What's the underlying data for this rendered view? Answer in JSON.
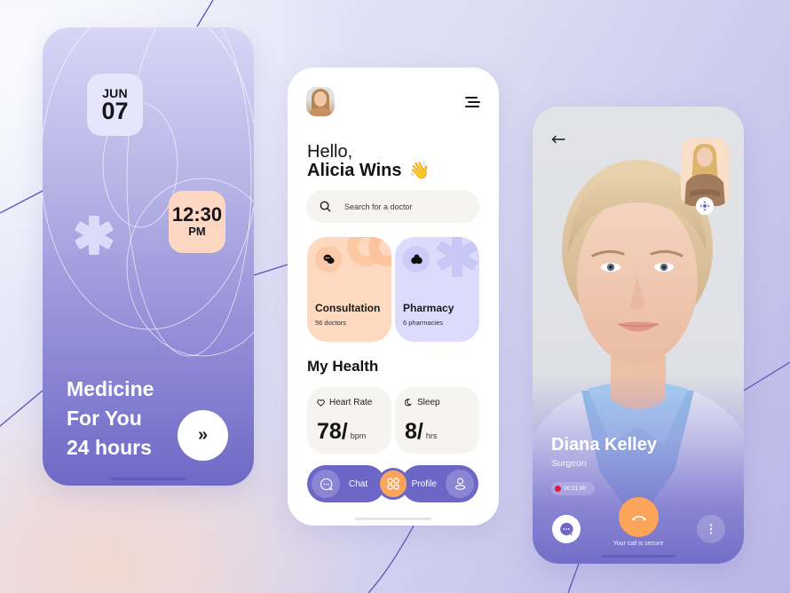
{
  "colors": {
    "accent_purple": "#6c67c6",
    "accent_orange": "#fba55c",
    "peach": "#fdd9c0",
    "lavender": "#dcdbfb",
    "card_bg": "#f6f4f0",
    "recording_red": "#e5193b"
  },
  "onboarding": {
    "date_month": "JUN",
    "date_day": "07",
    "time": "12:30",
    "time_period": "PM",
    "tagline": [
      "Medicine",
      "For You",
      "24 hours"
    ],
    "next_button_glyph": "»",
    "icons": [
      "medical-asterisk-icon",
      "double-chevron-right-icon"
    ]
  },
  "home": {
    "greeting": "Hello,",
    "user_name": "Alicia Wins",
    "wave_emoji": "👋",
    "search": {
      "placeholder": "Search for a doctor",
      "value": "",
      "icon": "search-icon"
    },
    "services": [
      {
        "title": "Consultation",
        "subtitle": "56 doctors",
        "icon": "chat-bubbles-icon"
      },
      {
        "title": "Pharmacy",
        "subtitle": "6 pharmacies",
        "icon": "pills-icon"
      }
    ],
    "section_title": "My Health",
    "metrics": [
      {
        "label": "Heart Rate",
        "value": "78/",
        "unit": "bpm",
        "icon": "heart-icon"
      },
      {
        "label": "Sleep",
        "value": "8/",
        "unit": "hrs",
        "icon": "moon-icon"
      }
    ],
    "nav": {
      "chat_label": "Chat",
      "profile_label": "Profile",
      "icons": [
        "chat-icon",
        "grid-icon",
        "user-icon"
      ]
    }
  },
  "call": {
    "doctor_name": "Diana Kelley",
    "doctor_role": "Surgeon",
    "duration": "00:21:45",
    "secure_text": "Your call is secure",
    "icons": [
      "back-arrow-icon",
      "switch-camera-icon",
      "message-icon",
      "end-call-icon",
      "more-vertical-icon"
    ]
  }
}
